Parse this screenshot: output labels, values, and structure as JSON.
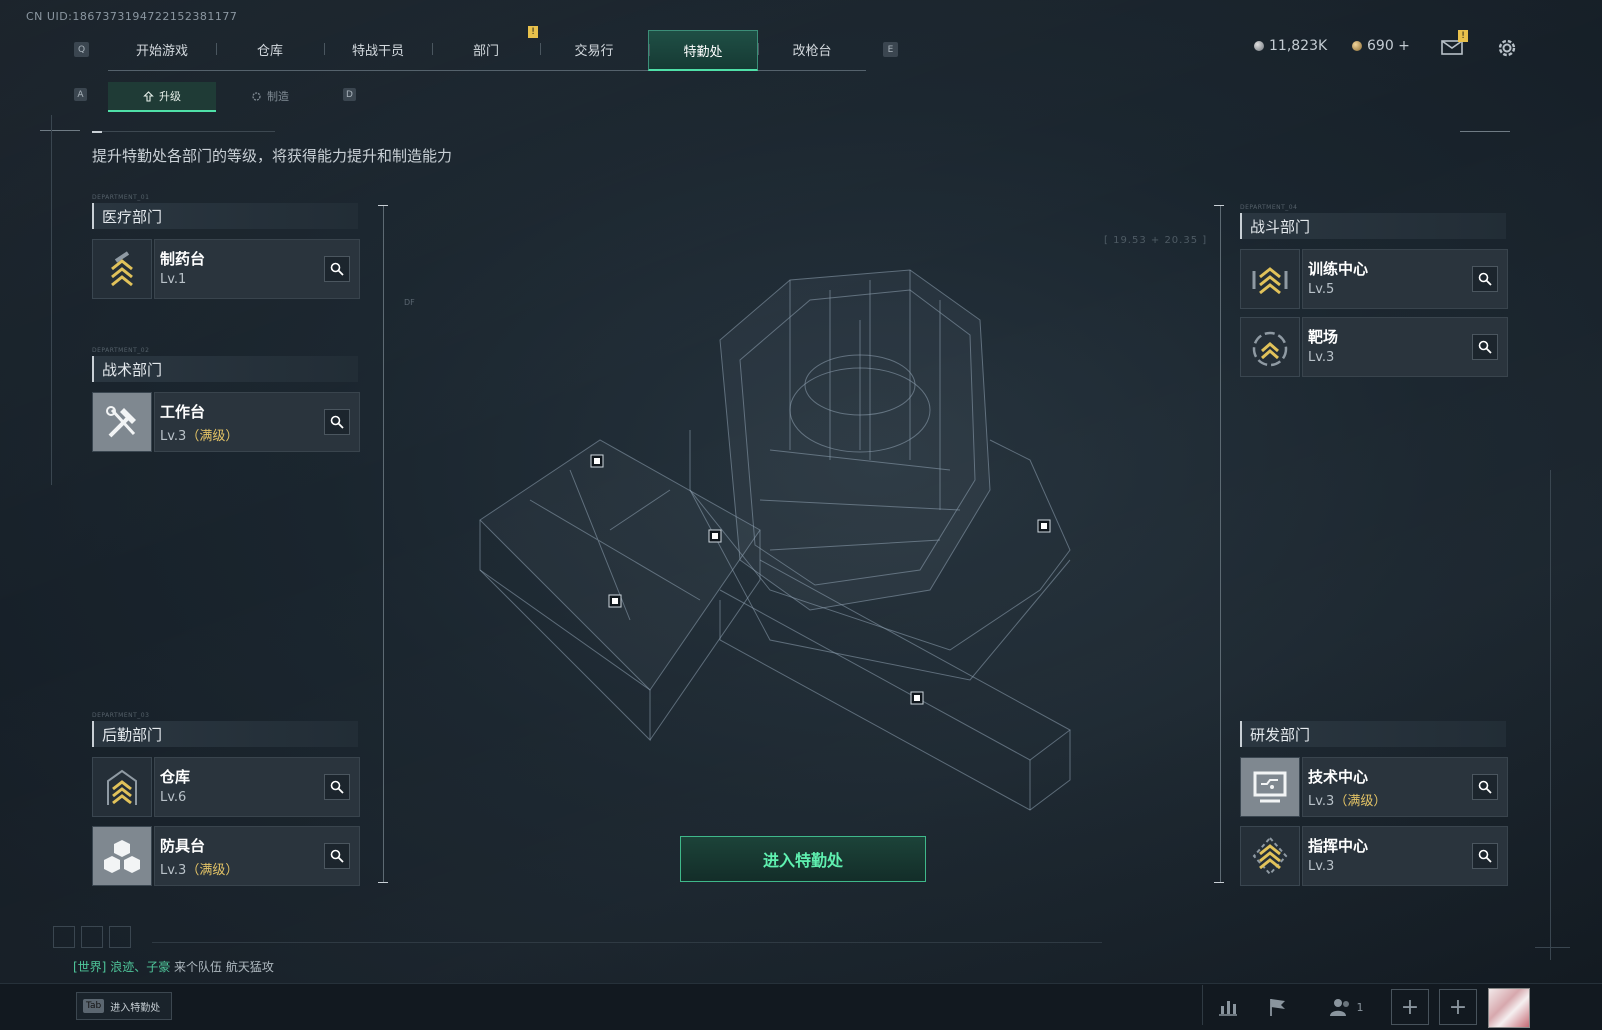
{
  "uid": "CN UID:1867373194722152381177",
  "keys": {
    "prev_tab": "Q",
    "next_tab": "E",
    "prev_subtab": "A",
    "next_subtab": "D"
  },
  "nav": {
    "tabs": [
      {
        "label": "开始游戏",
        "active": false
      },
      {
        "label": "仓库",
        "active": false
      },
      {
        "label": "特战干员",
        "active": false
      },
      {
        "label": "部门",
        "active": false,
        "alert": "!"
      },
      {
        "label": "交易行",
        "active": false
      },
      {
        "label": "特勤处",
        "active": true
      },
      {
        "label": "改枪台",
        "active": false
      }
    ]
  },
  "resources": {
    "silver": "11,823K",
    "gold": "690 +",
    "mail_alert": "!"
  },
  "subtabs": [
    {
      "label": "升级",
      "active": true
    },
    {
      "label": "制造",
      "active": false
    }
  ],
  "description": "提升特勤处各部门的等级，将获得能力提升和制造能力",
  "departments": {
    "medical": {
      "tag": "DEPARTMENT_01",
      "title": "医疗部门",
      "cards": [
        {
          "name": "制药台",
          "level": "Lv.1",
          "max": ""
        }
      ]
    },
    "tactical": {
      "tag": "DEPARTMENT_02",
      "title": "战术部门",
      "cards": [
        {
          "name": "工作台",
          "level": "Lv.3",
          "max": "（满级）"
        }
      ]
    },
    "logistics": {
      "tag": "DEPARTMENT_03",
      "title": "后勤部门",
      "cards": [
        {
          "name": "仓库",
          "level": "Lv.6",
          "max": ""
        },
        {
          "name": "防具台",
          "level": "Lv.3",
          "max": "（满级）"
        }
      ]
    },
    "combat": {
      "tag": "DEPARTMENT_04",
      "title": "战斗部门",
      "cards": [
        {
          "name": "训练中心",
          "level": "Lv.5",
          "max": ""
        },
        {
          "name": "靶场",
          "level": "Lv.3",
          "max": ""
        }
      ]
    },
    "research": {
      "title": "研发部门",
      "cards": [
        {
          "name": "技术中心",
          "level": "Lv.3",
          "max": "（满级）"
        },
        {
          "name": "指挥中心",
          "level": "Lv.3",
          "max": ""
        }
      ]
    }
  },
  "hud": {
    "coords": "[ 19.53 + 20.35 ]",
    "df_label": "DF"
  },
  "enter_button": "进入特勤处",
  "chat": {
    "channel": "[世界]",
    "sender": "浪迹、子豪",
    "message": "来个队伍 航天猛攻"
  },
  "bottom": {
    "tab_key": "Tab",
    "tab_hint": "进入特勤处",
    "friends_count": "1"
  },
  "colors": {
    "accent": "#4fe0a8",
    "max_level": "#e3c366",
    "alert": "#e8c14c"
  }
}
